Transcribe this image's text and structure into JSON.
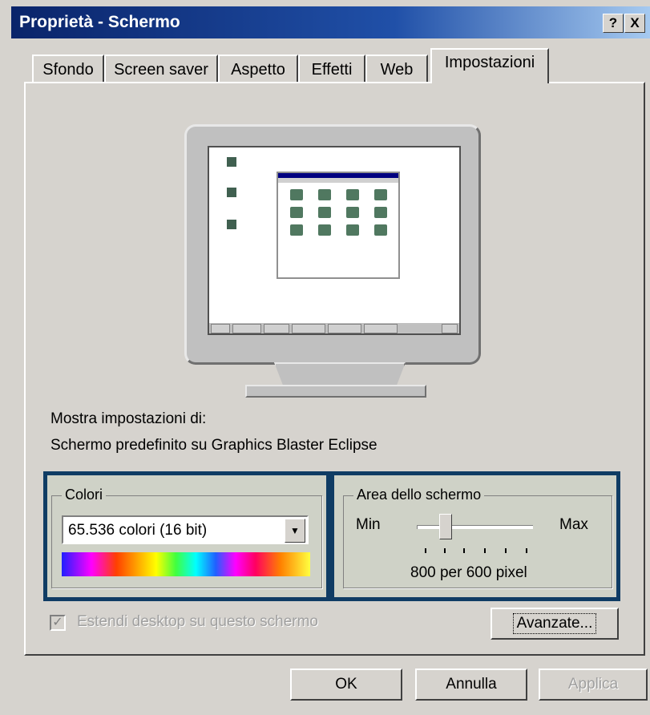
{
  "window": {
    "title": "Proprietà - Schermo",
    "help_label": "?",
    "close_label": "X"
  },
  "tabs": [
    {
      "label": "Sfondo"
    },
    {
      "label": "Screen saver"
    },
    {
      "label": "Aspetto"
    },
    {
      "label": "Effetti"
    },
    {
      "label": "Web"
    },
    {
      "label": "Impostazioni"
    }
  ],
  "active_tab": "Impostazioni",
  "display": {
    "show_settings_label": "Mostra impostazioni di:",
    "device_name": "Schermo predefinito su Graphics Blaster Eclipse"
  },
  "colors_group": {
    "title": "Colori",
    "selected_value": "65.536 colori (16 bit)"
  },
  "screen_area_group": {
    "title": "Area dello schermo",
    "min_label": "Min",
    "max_label": "Max",
    "resolution_text": "800 per 600 pixel",
    "slider_level_fraction": 0.25
  },
  "extend_checkbox": {
    "label": "Estendi desktop su questo schermo",
    "checked": true,
    "enabled": false
  },
  "advanced_button": {
    "label": "Avanzate..."
  },
  "footer": {
    "ok_label": "OK",
    "cancel_label": "Annulla",
    "apply_label": "Applica"
  },
  "colors": {
    "title_bar": "#0a246a",
    "dialog_bg": "#d6d3ce",
    "highlight_border": "#0f3c64",
    "highlight_fill": "#cfd2c7"
  }
}
